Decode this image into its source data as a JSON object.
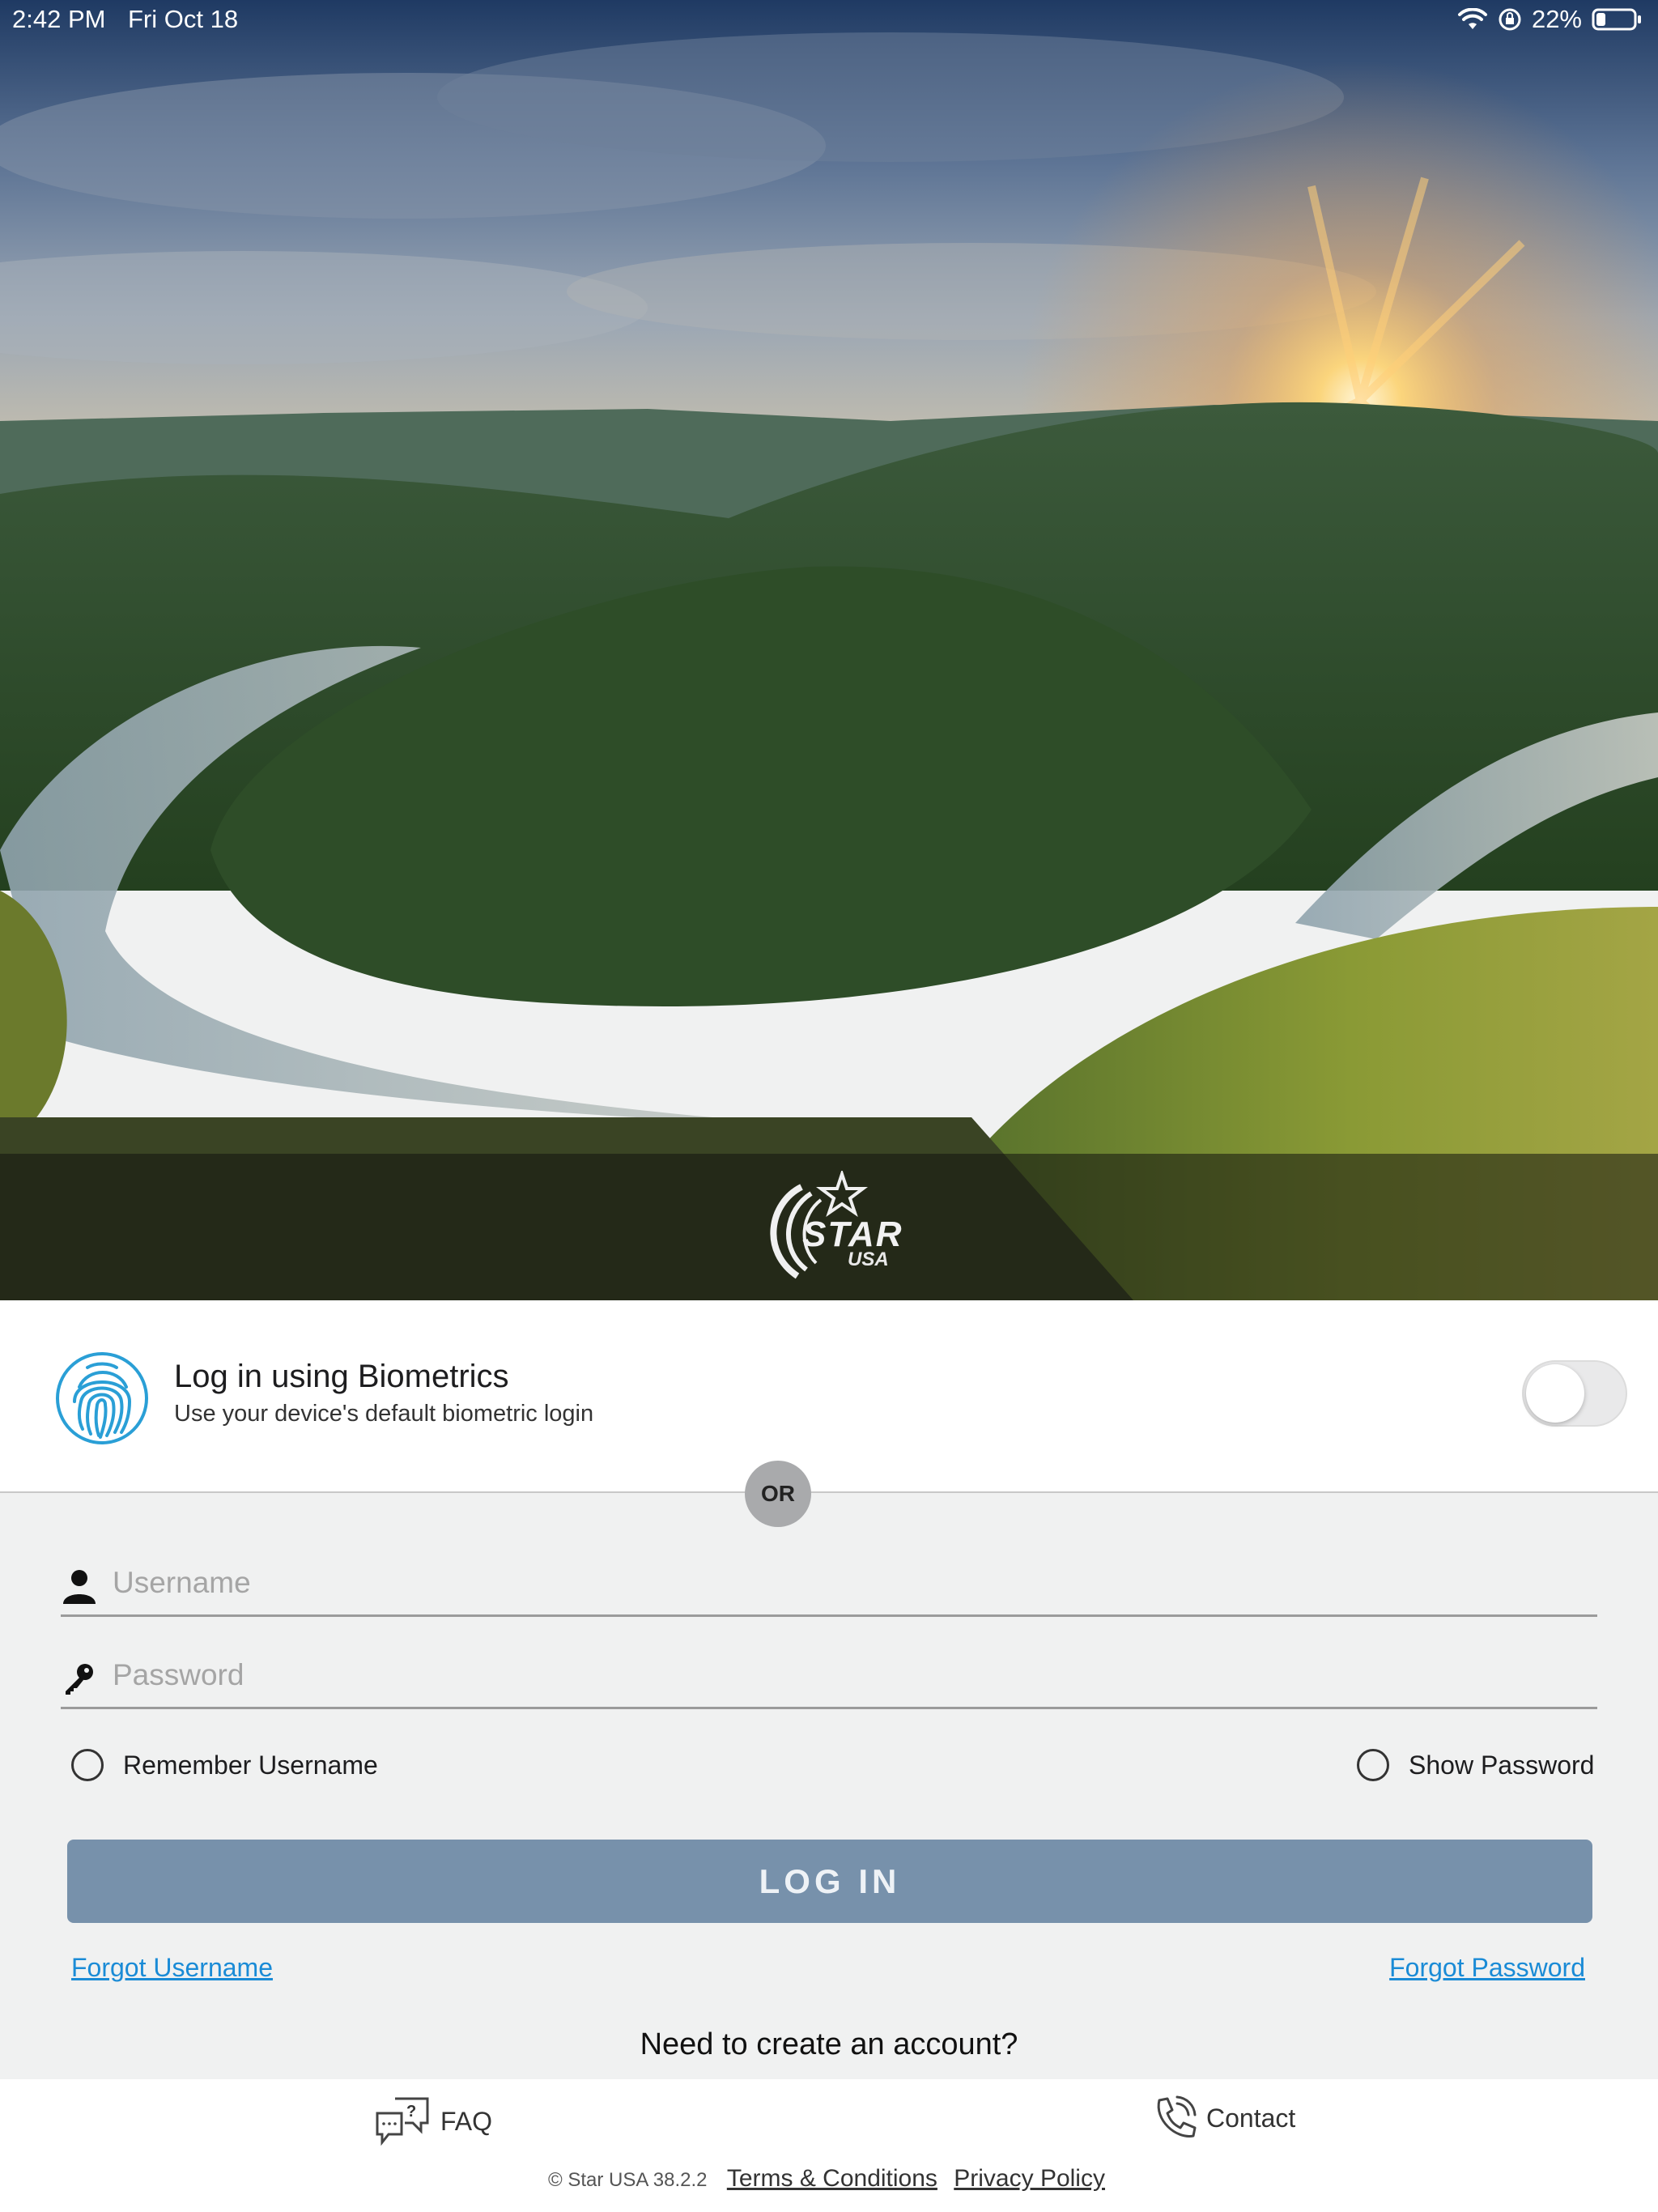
{
  "status_bar": {
    "time": "2:42 PM",
    "date": "Fri Oct 18",
    "battery": "22%",
    "icons": [
      "wifi-icon",
      "orientation-lock-icon",
      "battery-icon"
    ]
  },
  "brand": {
    "logo_text": "STAR",
    "logo_sub": "USA"
  },
  "biometrics": {
    "title": "Log in using Biometrics",
    "subtitle": "Use your device's default biometric login",
    "enabled": false
  },
  "divider": {
    "label": "OR"
  },
  "form": {
    "username_placeholder": "Username",
    "username_value": "",
    "password_placeholder": "Password",
    "password_value": "",
    "remember_username": "Remember Username",
    "show_password": "Show Password",
    "login_button": "LOG IN"
  },
  "links": {
    "forgot_username": "Forgot Username",
    "forgot_password": "Forgot Password",
    "create_account": "Need to create an account?"
  },
  "footer": {
    "faq": "FAQ",
    "contact": "Contact",
    "version": "© Star USA 38.2.2",
    "terms": "Terms & Conditions",
    "privacy": "Privacy Policy"
  },
  "colors": {
    "accent_link": "#1a8bd6",
    "login_button": "#7791ab",
    "fingerprint": "#2a9fd6",
    "background": "#f0f1f1"
  }
}
